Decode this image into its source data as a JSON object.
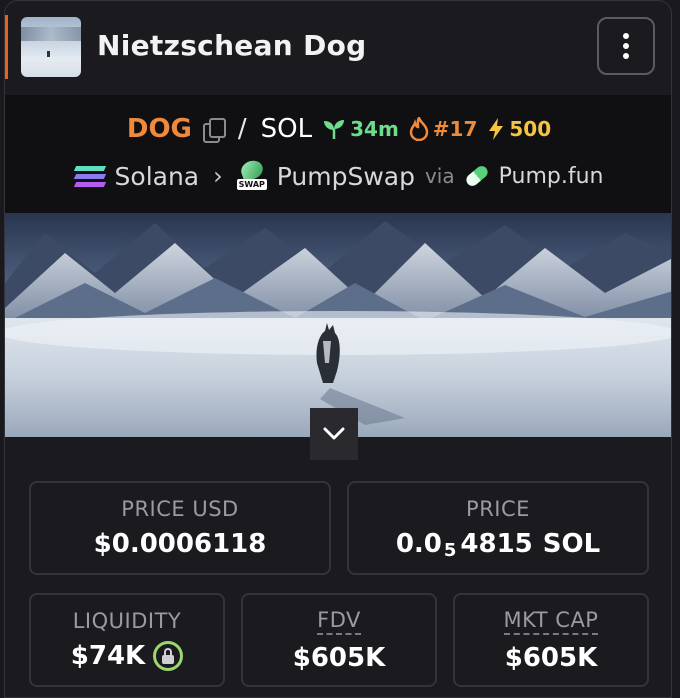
{
  "header": {
    "title": "Nietzschean Dog",
    "thumbnail": "token-thumbnail",
    "menu_icon": "more-vertical-icon"
  },
  "pair": {
    "base": "DOG",
    "separator": "/",
    "quote": "SOL",
    "age": "34m",
    "rank": "#17",
    "boosts": "500"
  },
  "chain": {
    "network": "Solana",
    "dex": "PumpSwap",
    "via_label": "via",
    "launchpad": "Pump.fun"
  },
  "colors": {
    "base_token": "#f08a3a",
    "age": "#6fdc8c",
    "rank": "#f08a3a",
    "boost": "#f5c542",
    "lock_ring": "#9bd66e"
  },
  "stats": {
    "price_usd": {
      "label": "PRICE USD",
      "value": "$0.0006118"
    },
    "price_native": {
      "label": "PRICE",
      "prefix": "0.0",
      "zeros": "5",
      "digits": "4815",
      "unit": "SOL"
    },
    "liquidity": {
      "label": "LIQUIDITY",
      "value": "$74K"
    },
    "fdv": {
      "label": "FDV",
      "value": "$605K"
    },
    "mkt_cap": {
      "label": "MKT CAP",
      "value": "$605K"
    }
  }
}
